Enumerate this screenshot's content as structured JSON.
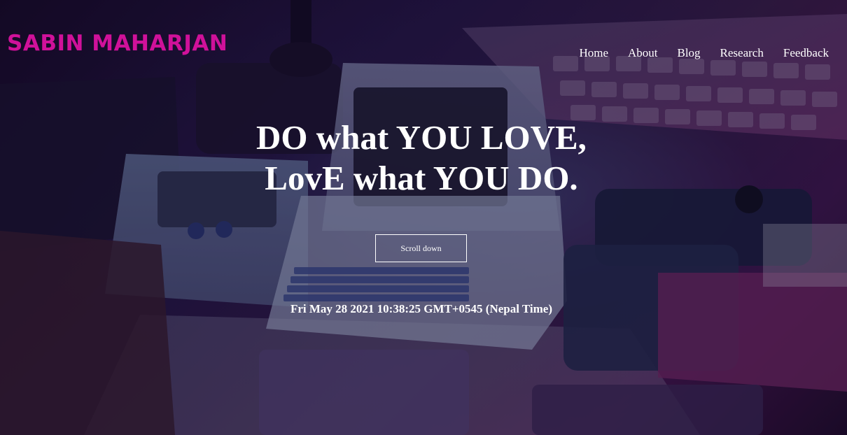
{
  "site": {
    "brand": "SABIN MAHARJAN"
  },
  "nav": {
    "items": [
      {
        "label": "Home"
      },
      {
        "label": "About"
      },
      {
        "label": "Blog"
      },
      {
        "label": "Research"
      },
      {
        "label": "Feedback"
      }
    ]
  },
  "hero": {
    "headline_line1": "DO what YOU LOVE,",
    "headline_line2": "LovE what YOU DO.",
    "scroll_button_label": "Scroll down",
    "datetime": "Fri May 28 2021 10:38:25 GMT+0545 (Nepal Time)"
  },
  "colors": {
    "brand": "#d0119a",
    "text": "#ffffff",
    "background": "#1b0f30"
  }
}
